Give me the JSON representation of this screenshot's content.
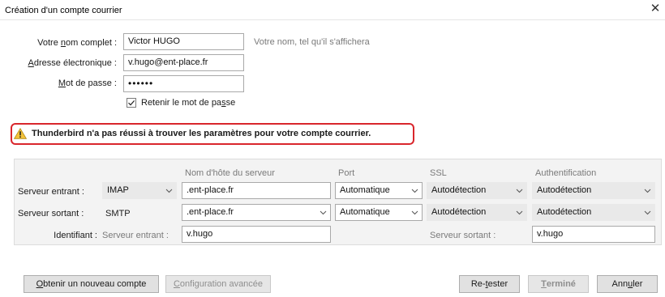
{
  "window": {
    "title": "Création d'un compte courrier",
    "close_glyph": "✕"
  },
  "account": {
    "name_label_pre": "Votre ",
    "name_label_key": "n",
    "name_label_post": "om complet :",
    "name_value": "Victor HUGO",
    "name_hint": "Votre nom, tel qu'il s'affichera",
    "email_label_key": "A",
    "email_label_post": "dresse électronique :",
    "email_value": "v.hugo@ent-place.fr",
    "password_label_key": "M",
    "password_label_post": "ot de passe :",
    "password_value": "••••••",
    "remember_pre": "Retenir le mot de pa",
    "remember_key": "s",
    "remember_post": "se",
    "remember_checked": true
  },
  "warning": {
    "text": "Thunderbird n'a pas réussi à trouver les paramètres pour votre compte courrier.",
    "icon": "warning-icon",
    "border_color": "#d9262c"
  },
  "server": {
    "headers": {
      "hostname": "Nom d'hôte du serveur",
      "port": "Port",
      "ssl": "SSL",
      "auth": "Authentification"
    },
    "incoming": {
      "label": "Serveur entrant :",
      "protocol": "IMAP",
      "hostname": ".ent-place.fr",
      "port": "Automatique",
      "ssl": "Autodétection",
      "auth": "Autodétection"
    },
    "outgoing": {
      "label": "Serveur sortant :",
      "protocol": "SMTP",
      "hostname": ".ent-place.fr",
      "port": "Automatique",
      "ssl": "Autodétection",
      "auth": "Autodétection"
    },
    "identity": {
      "label": "Identifiant :",
      "incoming_label": "Serveur entrant :",
      "incoming_value": "v.hugo",
      "outgoing_label": "Serveur sortant :",
      "outgoing_value": "v.hugo"
    }
  },
  "buttons": {
    "new_account_key": "O",
    "new_account_post": "btenir un nouveau compte",
    "advanced_key": "C",
    "advanced_post": "onfiguration avancée",
    "retest_pre": "Re-",
    "retest_key": "t",
    "retest_post": "ester",
    "done_key": "T",
    "done_post": "erminé",
    "cancel_pre": "Ann",
    "cancel_key": "u",
    "cancel_post": "ler"
  }
}
